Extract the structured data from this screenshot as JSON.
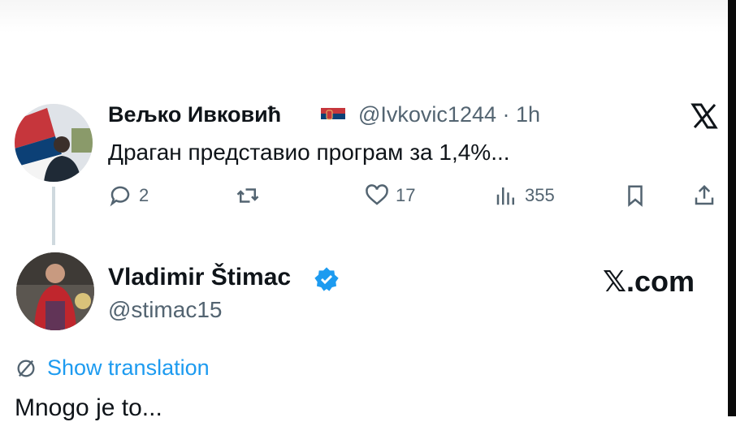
{
  "reply_tweet": {
    "author_name": "Вељко Ивковић",
    "handle_time": "@Ivkovic1244 · 1h",
    "text": "Драган представио програм за 1,4%...",
    "reply_count": "2",
    "like_count": "17",
    "view_count": "355"
  },
  "main_tweet": {
    "author_name": "Vladimir Štimac",
    "handle": "@stimac15",
    "show_translation": "Show translation",
    "text": "Mnogo je to..."
  },
  "branding": {
    "site": "𝕏.com"
  },
  "colors": {
    "accent": "#1d9bf0",
    "secondary_text": "#536471",
    "thread_line": "#cfd9de"
  }
}
